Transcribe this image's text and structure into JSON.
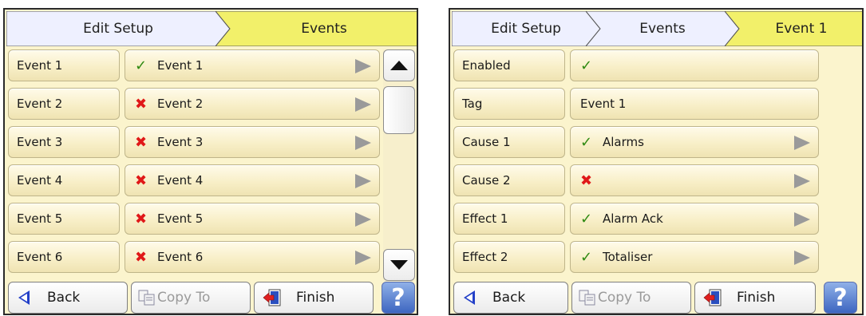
{
  "left": {
    "breadcrumbs": [
      "Edit Setup",
      "Events"
    ],
    "rows": [
      {
        "label": "Event 1",
        "status": "✓",
        "status_class": "ok",
        "value": "Event 1"
      },
      {
        "label": "Event 2",
        "status": "✖",
        "status_class": "no",
        "value": "Event 2"
      },
      {
        "label": "Event 3",
        "status": "✖",
        "status_class": "no",
        "value": "Event 3"
      },
      {
        "label": "Event 4",
        "status": "✖",
        "status_class": "no",
        "value": "Event 4"
      },
      {
        "label": "Event 5",
        "status": "✖",
        "status_class": "no",
        "value": "Event 5"
      },
      {
        "label": "Event 6",
        "status": "✖",
        "status_class": "no",
        "value": "Event 6"
      }
    ],
    "footer": {
      "back": "Back",
      "copy_to": "Copy To",
      "finish": "Finish",
      "help": "?"
    }
  },
  "right": {
    "breadcrumbs": [
      "Edit Setup",
      "Events",
      "Event 1"
    ],
    "rows": [
      {
        "label": "Enabled",
        "status": "✓",
        "status_class": "ok",
        "value": "",
        "arrow": false
      },
      {
        "label": "Tag",
        "status": "",
        "status_class": "",
        "value": "Event 1",
        "arrow": false
      },
      {
        "label": "Cause 1",
        "status": "✓",
        "status_class": "ok",
        "value": "Alarms",
        "arrow": true
      },
      {
        "label": "Cause 2",
        "status": "✖",
        "status_class": "no",
        "value": "",
        "arrow": true
      },
      {
        "label": "Effect 1",
        "status": "✓",
        "status_class": "ok",
        "value": "Alarm Ack",
        "arrow": true
      },
      {
        "label": "Effect 2",
        "status": "✓",
        "status_class": "ok",
        "value": "Totaliser",
        "arrow": true
      }
    ],
    "footer": {
      "back": "Back",
      "copy_to": "Copy To",
      "finish": "Finish",
      "help": "?"
    }
  },
  "colors": {
    "active_crumb": "#f2f06a",
    "inactive_crumb": "#eef0ff",
    "row_bg": "#f8efc8",
    "ok": "#2f8a12",
    "no": "#e01818"
  }
}
